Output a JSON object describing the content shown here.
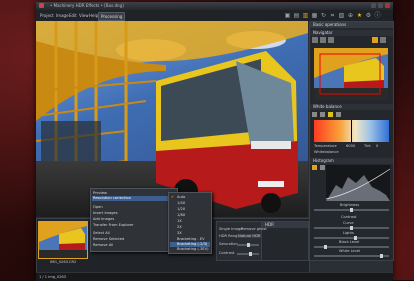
{
  "app": {
    "title": "• Machinery HDR Effects • [Bus.dng]",
    "menus": [
      "Project",
      "Image",
      "Edit",
      "View",
      "Help"
    ],
    "processing_label": "Processing"
  },
  "context_menu": {
    "items": [
      "Preview",
      "Resolution correction",
      "",
      "Open",
      "Insert Images",
      "Add Images",
      "Transfer From Explorer",
      "",
      "Select All",
      "Remove Selected",
      "Remove All"
    ],
    "highlighted": "Resolution correction"
  },
  "submenu": {
    "items": [
      "Auto",
      "1/4X",
      "1/2X",
      "1/8X",
      "1X",
      "2X",
      "3X",
      "Bracketing - EV",
      "Bracketing (-2/3)",
      "Bracketing (-3EV)"
    ],
    "checked": "Auto",
    "selected": "Bracketing (-2/3)"
  },
  "right_panel": {
    "header": "Basic operations",
    "navigator_label": "Navigator",
    "white_balance_label": "White balance",
    "temperature_label": "Temperature",
    "temperature_value": "6000",
    "tint_label": "Tint",
    "tint_value": "0",
    "wb_preset": "Whitebalance",
    "histogram_label": "Histogram",
    "brightness_label": "Brightness",
    "contrast_label": "Contrast",
    "curve_label": "Curve",
    "lights_label": "Lights",
    "black_level_label": "Black Level",
    "white_level_label": "White Level"
  },
  "hdr_panel": {
    "header": "HDR",
    "single_image_label": "Single Image",
    "remove_ghost_label": "Remove ghost",
    "hdr_range_label": "HDR Range",
    "hdr_range_value": "Natural HDR",
    "saturation_label": "Saturation",
    "contrast_label": "Contrast"
  },
  "thumbnail": {
    "filename": "IMG_0263.CR2"
  },
  "status": {
    "left": "1 / 1  img_0263",
    "right": ""
  },
  "colors": {
    "accent": "#e0a11e",
    "frame_red": "#5a1414",
    "panel_bg": "#24272b"
  }
}
